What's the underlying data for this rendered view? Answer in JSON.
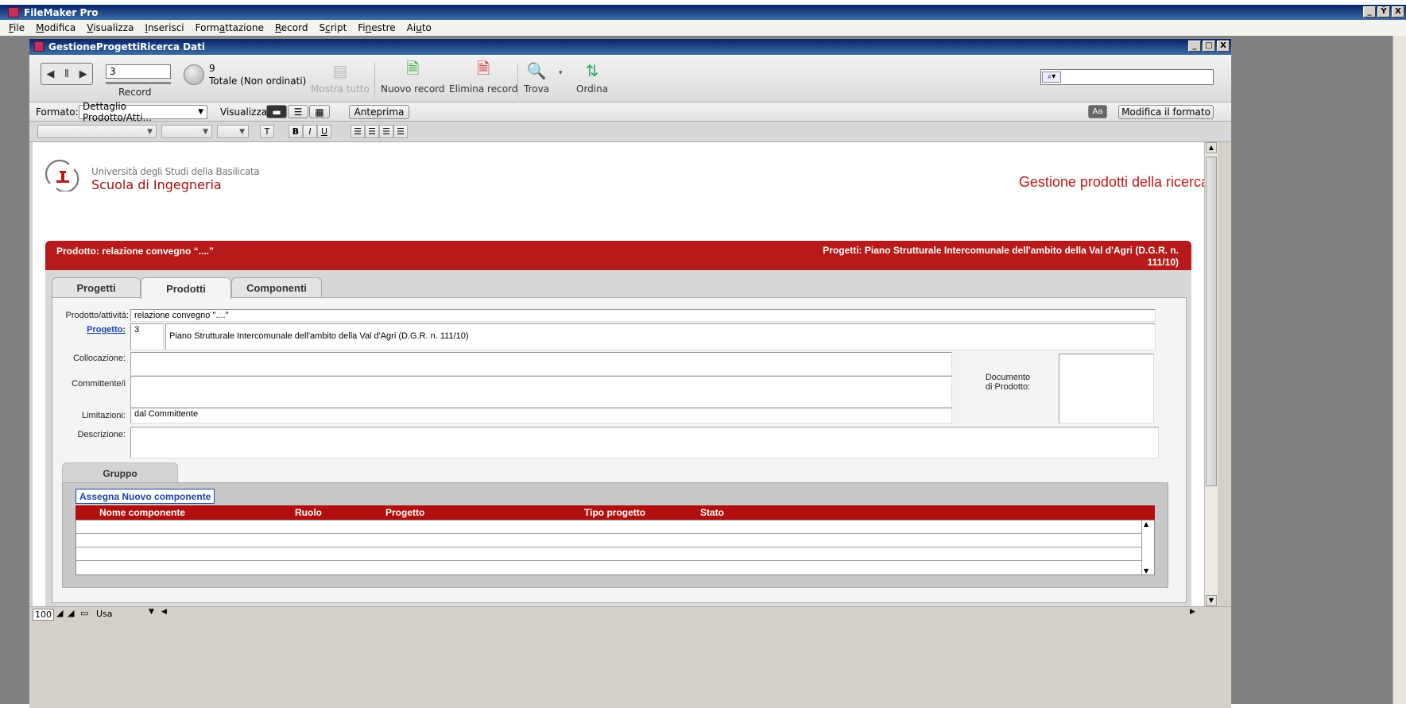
{
  "app": {
    "title": "FileMaker Pro",
    "controls": [
      "_",
      "Ÿ",
      "X"
    ]
  },
  "menu": [
    {
      "label": "File",
      "ul": "F",
      "rest": "ile"
    },
    {
      "label": "Modifica",
      "ul": "M",
      "rest": "odifica"
    },
    {
      "label": "Visualizza",
      "ul": "V",
      "rest": "isualizza"
    },
    {
      "label": "Inserisci",
      "ul": "I",
      "rest": "nserisci"
    },
    {
      "label": "Formattazione",
      "pre": "Form",
      "ul": "a",
      "rest": "ttazione"
    },
    {
      "label": "Record",
      "ul": "R",
      "rest": "ecord"
    },
    {
      "label": "Script",
      "pre": "S",
      "ul": "c",
      "rest": "ript"
    },
    {
      "label": "Finestre",
      "pre": "Fi",
      "ul": "n",
      "rest": "estre"
    },
    {
      "label": "Aiuto",
      "pre": "Ai",
      "ul": "u",
      "rest": "to"
    }
  ],
  "document": {
    "title": "GestioneProgettiRicerca Dati",
    "controls": [
      "_",
      "□",
      "X"
    ]
  },
  "toolbar": {
    "record_value": "3",
    "record_label": "Record",
    "found_count": "9",
    "found_label": "Totale (Non ordinati)",
    "show_all": "Mostra tutto",
    "new_record": "Nuovo record",
    "delete_record": "Elimina record",
    "find": "Trova",
    "sort": "Ordina",
    "search_icon": "⌕▾"
  },
  "layout_bar": {
    "format_label": "Formato:",
    "format_value": "Dettaglio Prodotto/Atti...",
    "view_label": "Visualizza:",
    "preview": "Anteprima",
    "aa": "Aa",
    "edit_layout": "Modifica il formato"
  },
  "format_bar": {
    "text_btn": "T",
    "bold": "B",
    "italic": "I",
    "underline": "U"
  },
  "header": {
    "university": "Università degli Studi della Basilicata",
    "school": "Scuola di Ingegneria",
    "page_title": "Gestione prodotti della ricerca"
  },
  "panel": {
    "product_title": "Prodotto: relazione convegno “....”",
    "project_title_line1": "Progetti: Piano Strutturale Intercomunale dell'ambito della Val d'Agri (D.G.R. n.",
    "project_title_line2": "111/10)"
  },
  "tabs": [
    "Progetti",
    "Prodotti",
    "Componenti"
  ],
  "form": {
    "product_label": "Prodotto/attività:",
    "product_value": "relazione convegno \"....\"",
    "project_label": "Progetto:",
    "project_id": "3",
    "project_name": "Piano Strutturale Intercomunale dell'ambito della Val d'Agri (D.G.R. n. 111/10)",
    "location_label": "Collocazione:",
    "location_value": "",
    "client_label": "Committente/i",
    "client_value": "",
    "limits_label": "Limitazioni:",
    "limits_value": "dal Committente",
    "description_label": "Descrizione:",
    "description_value": "",
    "document_label_1": "Documento",
    "document_label_2": "di Prodotto:"
  },
  "group": {
    "tab_label": "Gruppo",
    "assign_button": "Assegna Nuovo componente",
    "columns": [
      "Nome componente",
      "Ruolo",
      "Progetto",
      "Tipo progetto",
      "Stato"
    ]
  },
  "bottom": {
    "zoom": "100",
    "mode": "Usa"
  },
  "colors": {
    "accent_red": "#b61a1a",
    "title_red": "#c01818",
    "link_blue": "#1a44aa"
  }
}
